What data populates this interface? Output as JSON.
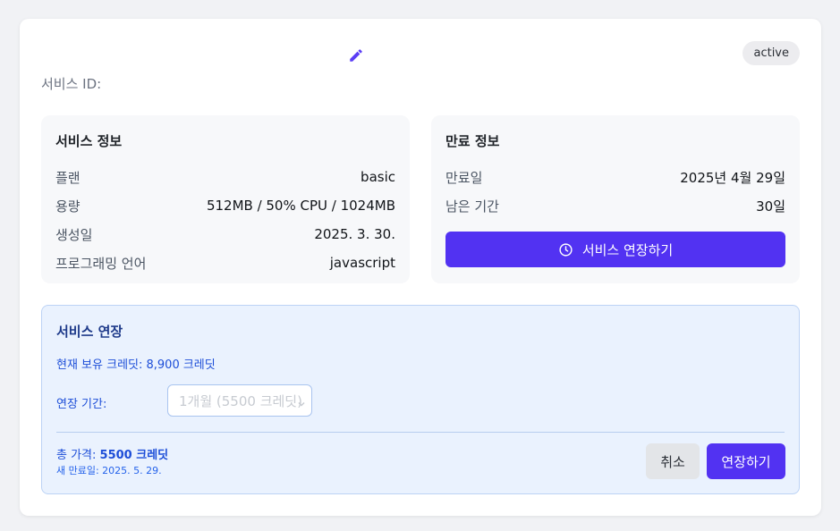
{
  "header": {
    "status_badge": "active",
    "service_id_label": "서비스 ID:",
    "service_id_value": ""
  },
  "service_info": {
    "title": "서비스 정보",
    "rows": [
      {
        "label": "플랜",
        "value": "basic"
      },
      {
        "label": "용량",
        "value": "512MB / 50% CPU / 1024MB"
      },
      {
        "label": "생성일",
        "value": "2025. 3. 30."
      },
      {
        "label": "프로그래밍 언어",
        "value": "javascript"
      }
    ]
  },
  "expiry_info": {
    "title": "만료 정보",
    "rows": [
      {
        "label": "만료일",
        "value": "2025년 4월 29일"
      },
      {
        "label": "남은 기간",
        "value": "30일"
      }
    ],
    "extend_button_label": "서비스 연장하기"
  },
  "extension": {
    "title": "서비스 연장",
    "credits_text": "현재 보유 크레딧: 8,900 크레딧",
    "period_label": "연장 기간:",
    "period_selected": "1개월 (5500 크레딧)",
    "total_label": "총 가격: ",
    "total_value": "5500 크레딧",
    "new_expiry_text": "새 만료일: 2025. 5. 29.",
    "cancel_label": "취소",
    "confirm_label": "연장하기"
  },
  "icons": {
    "edit": "pencil-icon",
    "clock": "clock-icon",
    "select_arrow": "chevron-down-icon"
  },
  "colors": {
    "accent": "#5232f2",
    "info_bg": "#eaf2fe",
    "info_text": "#1d4ed8"
  }
}
